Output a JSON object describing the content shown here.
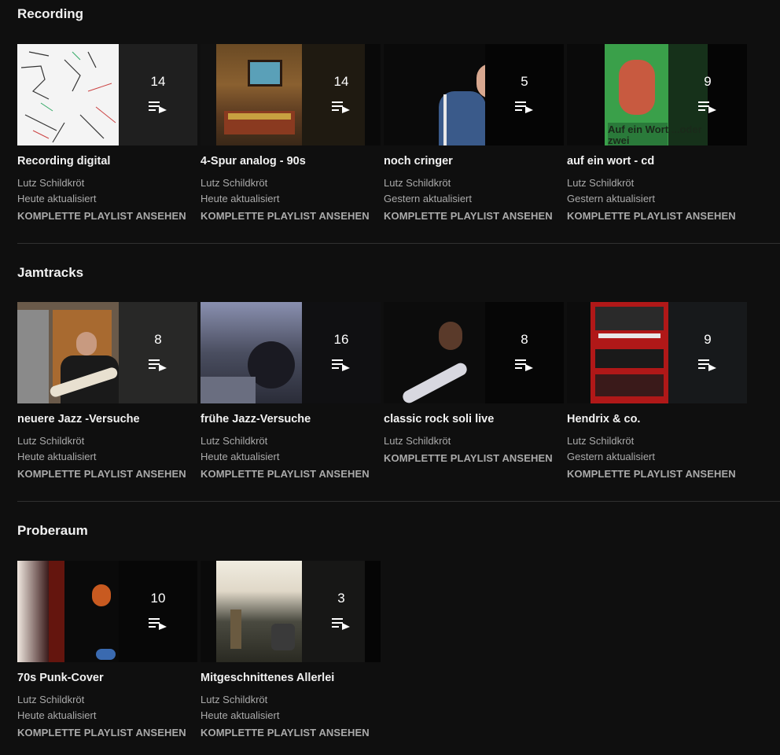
{
  "icons": {
    "playlist": "playlist-play-icon"
  },
  "sections": [
    {
      "title": "Recording",
      "cards": [
        {
          "title": "Recording digital",
          "count": "14",
          "channel": "Lutz Schildkröt",
          "updated": "Heute aktualisiert",
          "view_all": "KOMPLETTE PLAYLIST ANSEHEN"
        },
        {
          "title": "4-Spur analog - 90s",
          "count": "14",
          "channel": "Lutz Schildkröt",
          "updated": "Heute aktualisiert",
          "view_all": "KOMPLETTE PLAYLIST ANSEHEN"
        },
        {
          "title": "noch cringer",
          "count": "5",
          "channel": "Lutz Schildkröt",
          "updated": "Gestern aktualisiert",
          "view_all": "KOMPLETTE PLAYLIST ANSEHEN"
        },
        {
          "title": "auf ein wort - cd",
          "count": "9",
          "channel": "Lutz Schildkröt",
          "updated": "Gestern aktualisiert",
          "view_all": "KOMPLETTE PLAYLIST ANSEHEN",
          "thumb_text": "Auf ein Wort ...oder zwei"
        }
      ]
    },
    {
      "title": "Jamtracks",
      "cards": [
        {
          "title": "neuere Jazz -Versuche",
          "count": "8",
          "channel": "Lutz Schildkröt",
          "updated": "Heute aktualisiert",
          "view_all": "KOMPLETTE PLAYLIST ANSEHEN"
        },
        {
          "title": "frühe Jazz-Versuche",
          "count": "16",
          "channel": "Lutz Schildkröt",
          "updated": "Heute aktualisiert",
          "view_all": "KOMPLETTE PLAYLIST ANSEHEN"
        },
        {
          "title": "classic rock soli live",
          "count": "8",
          "channel": "Lutz Schildkröt",
          "view_all": "KOMPLETTE PLAYLIST ANSEHEN"
        },
        {
          "title": "Hendrix & co.",
          "count": "9",
          "channel": "Lutz Schildkröt",
          "updated": "Gestern aktualisiert",
          "view_all": "KOMPLETTE PLAYLIST ANSEHEN"
        }
      ]
    },
    {
      "title": "Proberaum",
      "cards": [
        {
          "title": "70s Punk-Cover",
          "count": "10",
          "channel": "Lutz Schildkröt",
          "updated": "Heute aktualisiert",
          "view_all": "KOMPLETTE PLAYLIST ANSEHEN"
        },
        {
          "title": "Mitgeschnittenes Allerlei",
          "count": "3",
          "channel": "Lutz Schildkröt",
          "updated": "Heute aktualisiert",
          "view_all": "KOMPLETTE PLAYLIST ANSEHEN"
        }
      ]
    }
  ]
}
